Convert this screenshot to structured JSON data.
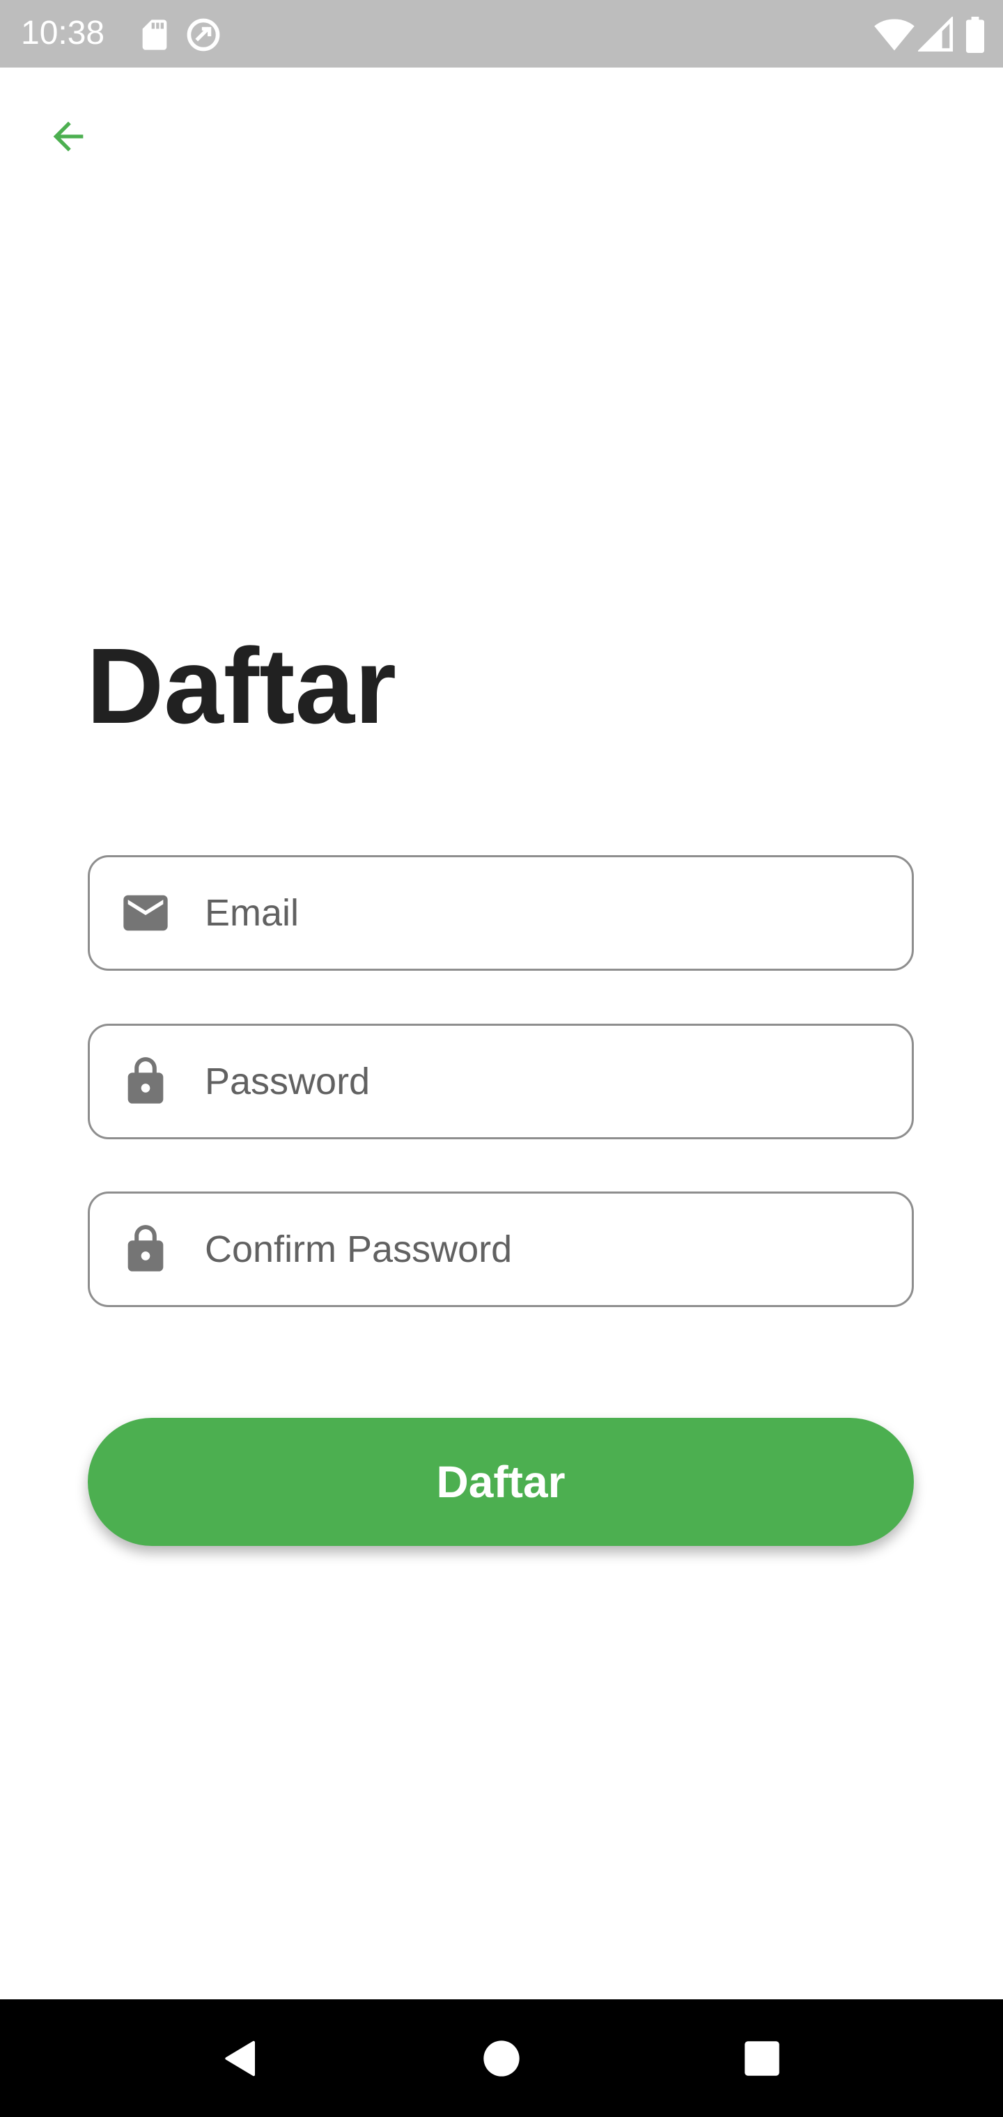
{
  "status_bar": {
    "time": "10:38",
    "left_icons": [
      "sd-card-icon",
      "sync-icon"
    ],
    "right_icons": [
      "wifi-icon",
      "signal-icon",
      "battery-icon"
    ],
    "background_color": "#bdbdbd"
  },
  "header": {
    "back_icon": "arrow-back-icon",
    "back_color": "#4caf50"
  },
  "main": {
    "title": "Daftar",
    "fields": [
      {
        "icon": "mail-icon",
        "placeholder": "Email",
        "value": ""
      },
      {
        "icon": "lock-icon",
        "placeholder": "Password",
        "value": ""
      },
      {
        "icon": "lock-icon",
        "placeholder": "Confirm Password",
        "value": ""
      }
    ],
    "submit_label": "Daftar",
    "accent_color": "#4caf50"
  },
  "nav_bar": {
    "icons": [
      "nav-back-icon",
      "nav-home-icon",
      "nav-recents-icon"
    ]
  }
}
